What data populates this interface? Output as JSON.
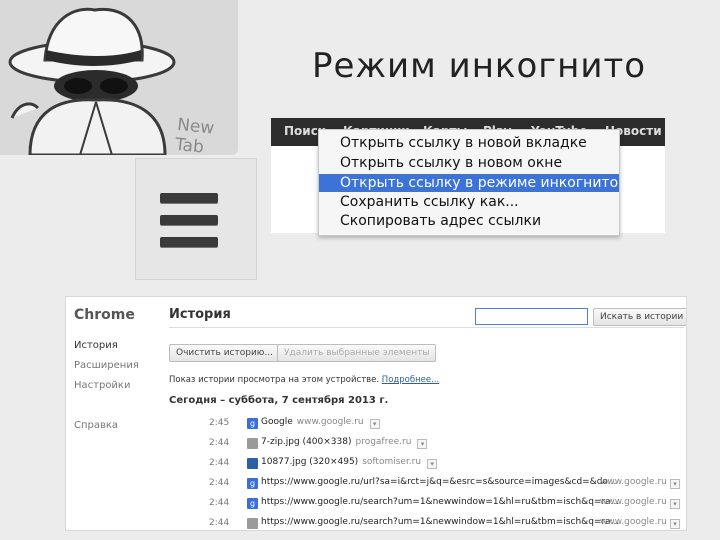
{
  "tile": {
    "newtab_label": "New Tab"
  },
  "slide_title": "Режим инкогнито",
  "search_bar": {
    "nav": [
      "Поиск",
      "Картинки",
      "Карты",
      "Play",
      "YouTube",
      "Новости"
    ]
  },
  "context_menu": {
    "items": [
      {
        "label": "Открыть ссылку в новой вкладке",
        "active": false
      },
      {
        "label": "Открыть ссылку в новом окне",
        "active": false
      },
      {
        "label": "Открыть ссылку в режиме инкогнито",
        "active": true
      },
      {
        "label": "Сохранить ссылку как...",
        "active": false
      },
      {
        "label": "Скопировать адрес ссылки",
        "active": false
      }
    ],
    "highlight_color": "#3b73d6"
  },
  "history": {
    "brand": "Chrome",
    "sidebar": [
      "История",
      "Расширения",
      "Настройки",
      "Справка"
    ],
    "title": "История",
    "search_value": "",
    "search_button": "Искать в истории",
    "clear_button": "Очистить историю...",
    "remove_button": "Удалить выбранные элементы",
    "note": "Показ истории просмотра на этом устройстве.",
    "note_link": "Подробнее...",
    "date": "Сегодня – суббота, 7 сентября 2013 г.",
    "rows": [
      {
        "time": "2:45",
        "icon": "google-favicon",
        "icon_color": "#3a6fd8",
        "icon_glyph": "g",
        "text": "Google",
        "inline_domain": "www.google.ru",
        "domain": ""
      },
      {
        "time": "2:44",
        "icon": "file-icon",
        "icon_color": "#9a9a9a",
        "icon_glyph": "",
        "text": "7-zip.jpg (400×338)",
        "inline_domain": "progafree.ru",
        "domain": ""
      },
      {
        "time": "2:44",
        "icon": "image-favicon",
        "icon_color": "#2b5faa",
        "icon_glyph": "",
        "text": "10877.jpg (320×495)",
        "inline_domain": "softomiser.ru",
        "domain": ""
      },
      {
        "time": "2:44",
        "icon": "google-favicon",
        "icon_color": "#3a6fd8",
        "icon_glyph": "g",
        "text": "https://www.google.ru/url?sa=i&rct=j&q=&esrc=s&source=images&cd=&do...",
        "inline_domain": "",
        "domain": "www.google.ru"
      },
      {
        "time": "2:44",
        "icon": "google-favicon",
        "icon_color": "#3a6fd8",
        "icon_glyph": "g",
        "text": "https://www.google.ru/search?um=1&newwindow=1&hl=ru&tbm=isch&q=ra...",
        "inline_domain": "",
        "domain": "www.google.ru"
      },
      {
        "time": "2:44",
        "icon": "file-icon",
        "icon_color": "#9a9a9a",
        "icon_glyph": "",
        "text": "https://www.google.ru/search?um=1&newwindow=1&hl=ru&tbm=isch&q=ra...",
        "inline_domain": "",
        "domain": "www.google.ru"
      }
    ]
  }
}
